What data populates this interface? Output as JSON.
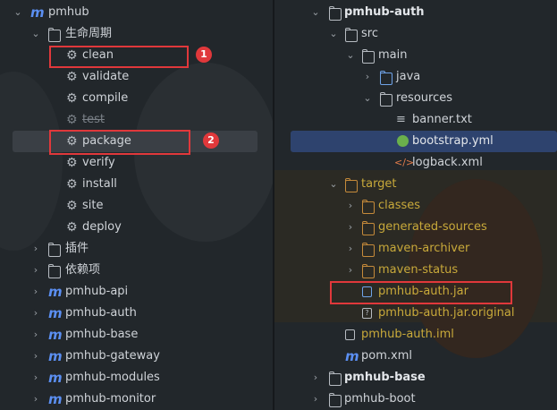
{
  "left_tree": {
    "root": "pmhub",
    "lifecycle_folder": "生命周期",
    "lifecycle_items": [
      "clean",
      "validate",
      "compile",
      "test",
      "package",
      "verify",
      "install",
      "site",
      "deploy"
    ],
    "plugins_folder": "插件",
    "deps_folder": "依赖项",
    "modules": [
      "pmhub-api",
      "pmhub-auth",
      "pmhub-base",
      "pmhub-gateway",
      "pmhub-modules",
      "pmhub-monitor"
    ]
  },
  "right_tree": {
    "module": "pmhub-auth",
    "src": "src",
    "main": "main",
    "java": "java",
    "resources": "resources",
    "resource_files": [
      "banner.txt",
      "bootstrap.yml",
      "logback.xml"
    ],
    "target": "target",
    "target_folders": [
      "classes",
      "generated-sources",
      "maven-archiver",
      "maven-status"
    ],
    "jar": "pmhub-auth.jar",
    "jar_original": "pmhub-auth.jar.original",
    "iml": "pmhub-auth.iml",
    "pom": "pom.xml",
    "next_modules": [
      "pmhub-base",
      "pmhub-boot"
    ]
  },
  "annotations": {
    "badge_1": "1",
    "badge_2": "2"
  },
  "colors": {
    "accent_blue": "#5b8ff2",
    "highlight_red": "#e0383b",
    "target_orange": "#c8a93a"
  }
}
